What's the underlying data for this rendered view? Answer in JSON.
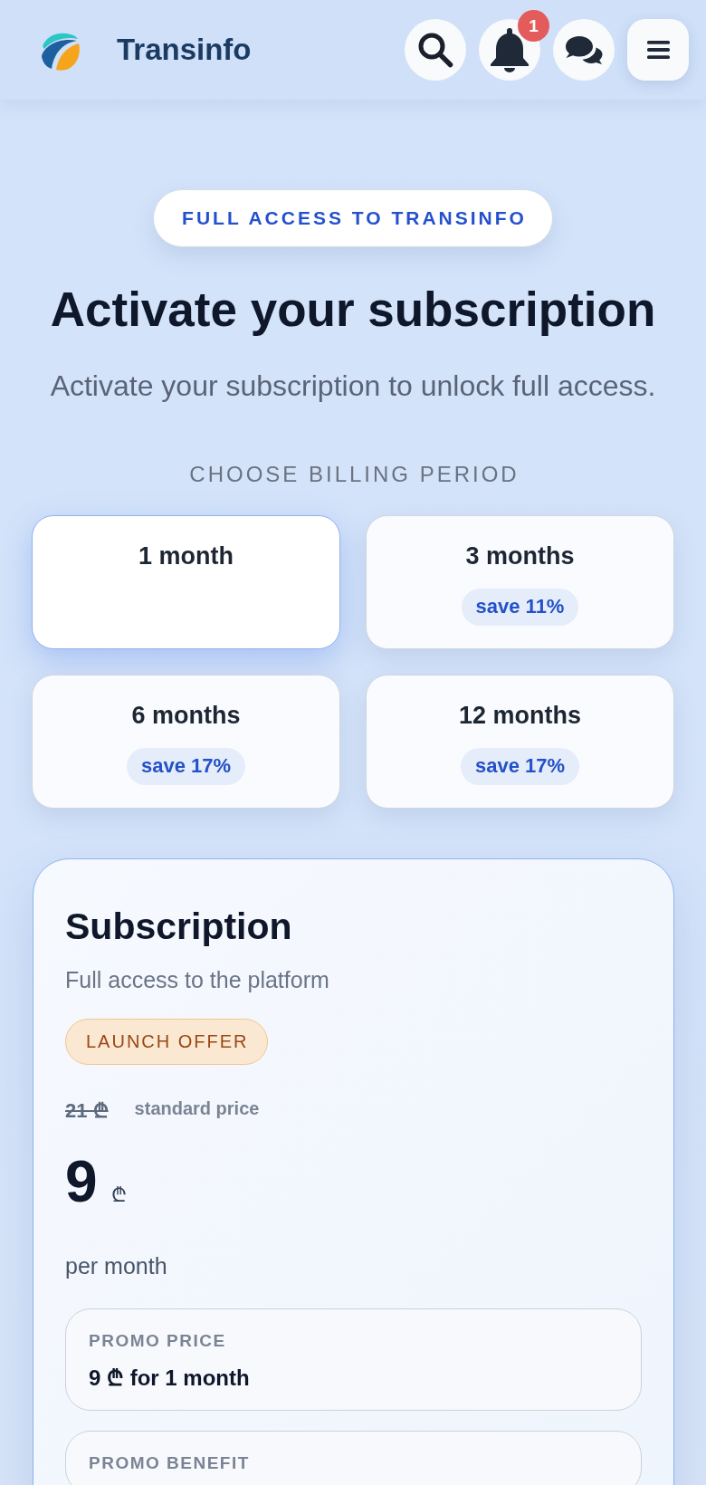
{
  "header": {
    "title": "Transinfo",
    "notification_count": "1"
  },
  "hero": {
    "tag": "FULL ACCESS TO TRANSINFO",
    "title": "Activate your subscription",
    "subtitle": "Activate your subscription to unlock full access."
  },
  "billing": {
    "label": "CHOOSE BILLING PERIOD",
    "options": [
      {
        "label": "1 month",
        "selected": true
      },
      {
        "label": "3 months",
        "selected": false,
        "badge": "save 11%"
      },
      {
        "label": "6 months",
        "selected": false,
        "badge": "save 17%"
      },
      {
        "label": "12 months",
        "selected": false,
        "badge": "save 17%"
      }
    ]
  },
  "plan": {
    "title": "Subscription",
    "description": "Full access to the platform",
    "tag": "LAUNCH OFFER",
    "old_price": "21 ₾",
    "old_price_note": "standard price",
    "price": "9",
    "currency": "₾",
    "period": "per month",
    "details": [
      {
        "label": "PROMO PRICE",
        "value": "9 ₾ for 1 month"
      },
      {
        "label": "PROMO BENEFIT"
      }
    ]
  }
}
